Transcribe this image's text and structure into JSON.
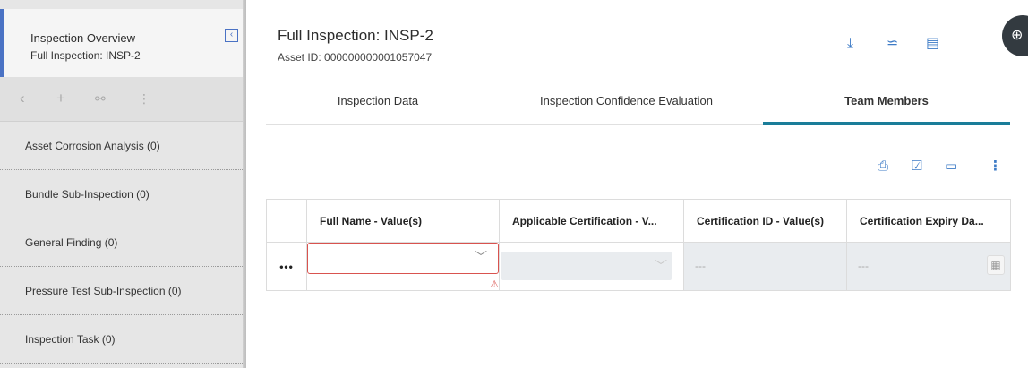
{
  "sidebar": {
    "title": "Inspection Overview",
    "subtitle": "Full Inspection: INSP-2",
    "collapse_icon": "chevron-left-icon",
    "toolbar": [
      "back-icon",
      "add-icon",
      "link-icon",
      "more-vertical-icon"
    ],
    "items": [
      {
        "label": "Asset Corrosion Analysis (0)"
      },
      {
        "label": "Bundle Sub-Inspection (0)"
      },
      {
        "label": "General Finding (0)"
      },
      {
        "label": "Pressure Test Sub-Inspection (0)"
      },
      {
        "label": "Inspection Task (0)"
      }
    ]
  },
  "header": {
    "title": "Full Inspection: INSP-2",
    "asset_id": "Asset ID: 000000000001057047",
    "icons": [
      "download-icon",
      "compare-icon",
      "clipboard-icon"
    ]
  },
  "tabs": [
    {
      "label": "Inspection Data",
      "active": false
    },
    {
      "label": "Inspection Confidence Evaluation",
      "active": false
    },
    {
      "label": "Team Members",
      "active": true
    }
  ],
  "grid": {
    "toolbar_icons": [
      "print-icon",
      "checkbox-icon",
      "save-icon",
      "more-vertical-icon"
    ],
    "columns": [
      "",
      "Full Name - Value(s)",
      "Applicable Certification - V...",
      "Certification ID - Value(s)",
      "Certification Expiry Da..."
    ],
    "rows": [
      {
        "actions": "•••",
        "full_name": "",
        "applicable_certification": "",
        "certification_id": "---",
        "certification_expiry": "---"
      }
    ]
  },
  "colors": {
    "accent": "#4a72c4",
    "tab_underline": "#1a7d99",
    "icon_blue": "#3d7bc6",
    "error": "#d9534f"
  }
}
